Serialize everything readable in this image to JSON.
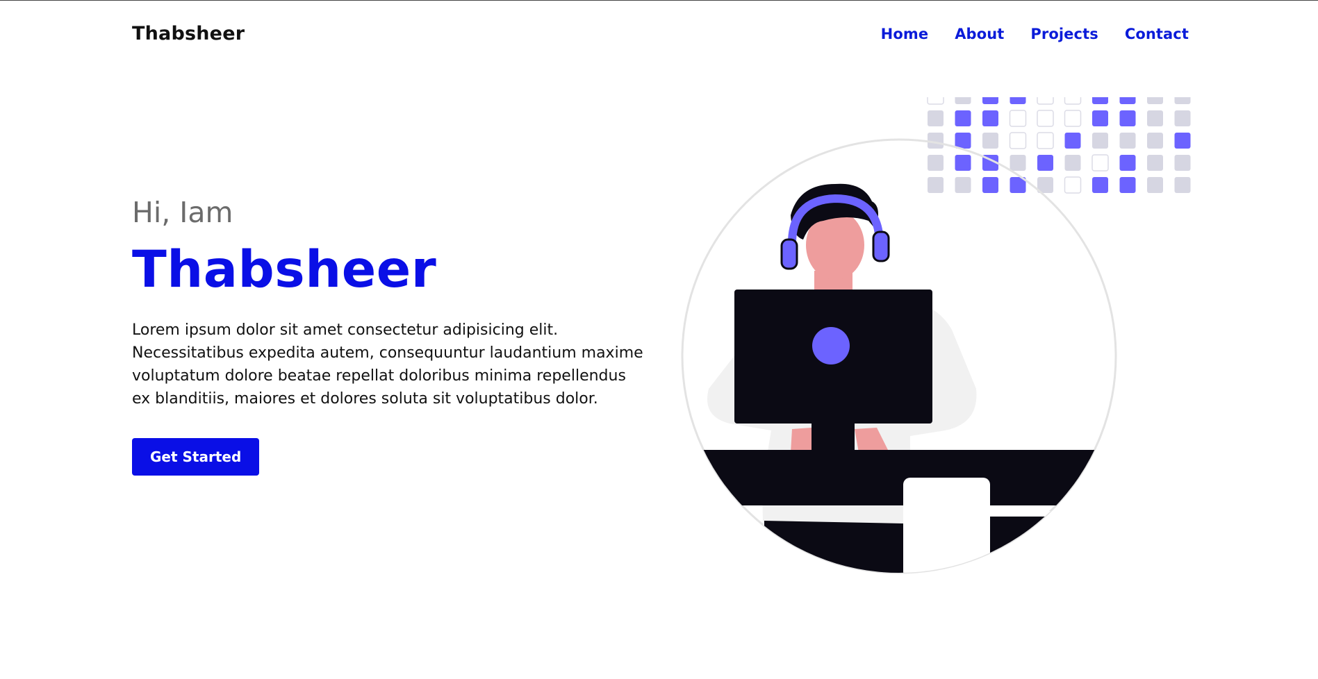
{
  "header": {
    "logo": "Thabsheer",
    "nav": [
      "Home",
      "About",
      "Projects",
      "Contact"
    ]
  },
  "hero": {
    "greeting": "Hi, Iam",
    "name": "Thabsheer",
    "description": "Lorem ipsum dolor sit amet consectetur adipisicing elit. Necessitatibus expedita autem, consequuntur laudantium maxime voluptatum dolore beatae repellat doloribus minima repellendus ex blanditiis, maiores et dolores soluta sit voluptatibus dolor.",
    "cta_label": "Get Started"
  },
  "colors": {
    "accent": "#0a0fe6",
    "illustration_purple": "#6c63ff",
    "grid_gray": "#d6d6e2",
    "dark": "#0b0a14",
    "skin": "#ee9d9d"
  }
}
